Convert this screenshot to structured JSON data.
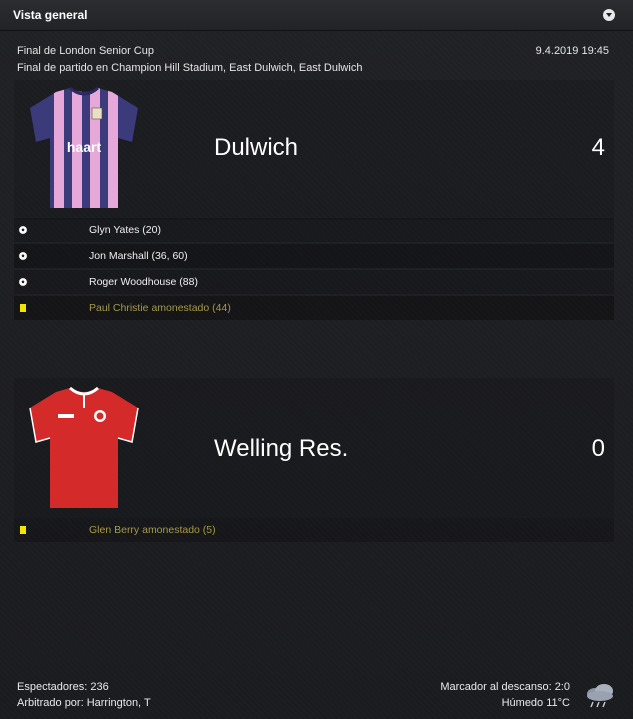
{
  "header": {
    "title": "Vista general"
  },
  "match": {
    "competition": "Final de London Senior Cup",
    "venue": "Final de partido en Champion Hill Stadium, East Dulwich, East Dulwich",
    "datetime": "9.4.2019 19:45"
  },
  "home": {
    "name": "Dulwich",
    "score": "4",
    "kit_sponsor": "haart",
    "kit_colors": {
      "primary": "#3b3a7a",
      "stripe": "#e5a8d8"
    },
    "events": [
      {
        "type": "goal",
        "icon": "ball-icon",
        "text": "Glyn Yates (20)"
      },
      {
        "type": "goal",
        "icon": "ball-icon",
        "text": "Jon Marshall (36, 60)"
      },
      {
        "type": "goal",
        "icon": "ball-icon",
        "text": "Roger Woodhouse (88)"
      },
      {
        "type": "booking",
        "icon": "yellow-card-icon",
        "text": "Paul Christie amonestado (44)"
      }
    ]
  },
  "away": {
    "name": "Welling Res.",
    "score": "0",
    "kit_colors": {
      "primary": "#d42a2a",
      "trim": "#ffffff"
    },
    "events": [
      {
        "type": "booking",
        "icon": "yellow-card-icon",
        "text": "Glen Berry amonestado (5)"
      }
    ]
  },
  "footer": {
    "attendance": "Espectadores: 236",
    "referee": "Arbitrado por: Harrington, T",
    "half_time": "Marcador al descanso: 2:0",
    "weather": "Húmedo 11°C",
    "weather_icon": "rain-cloud-icon"
  },
  "colors": {
    "yellow_card": "#f5e400",
    "booking_text": "#a59a48"
  }
}
